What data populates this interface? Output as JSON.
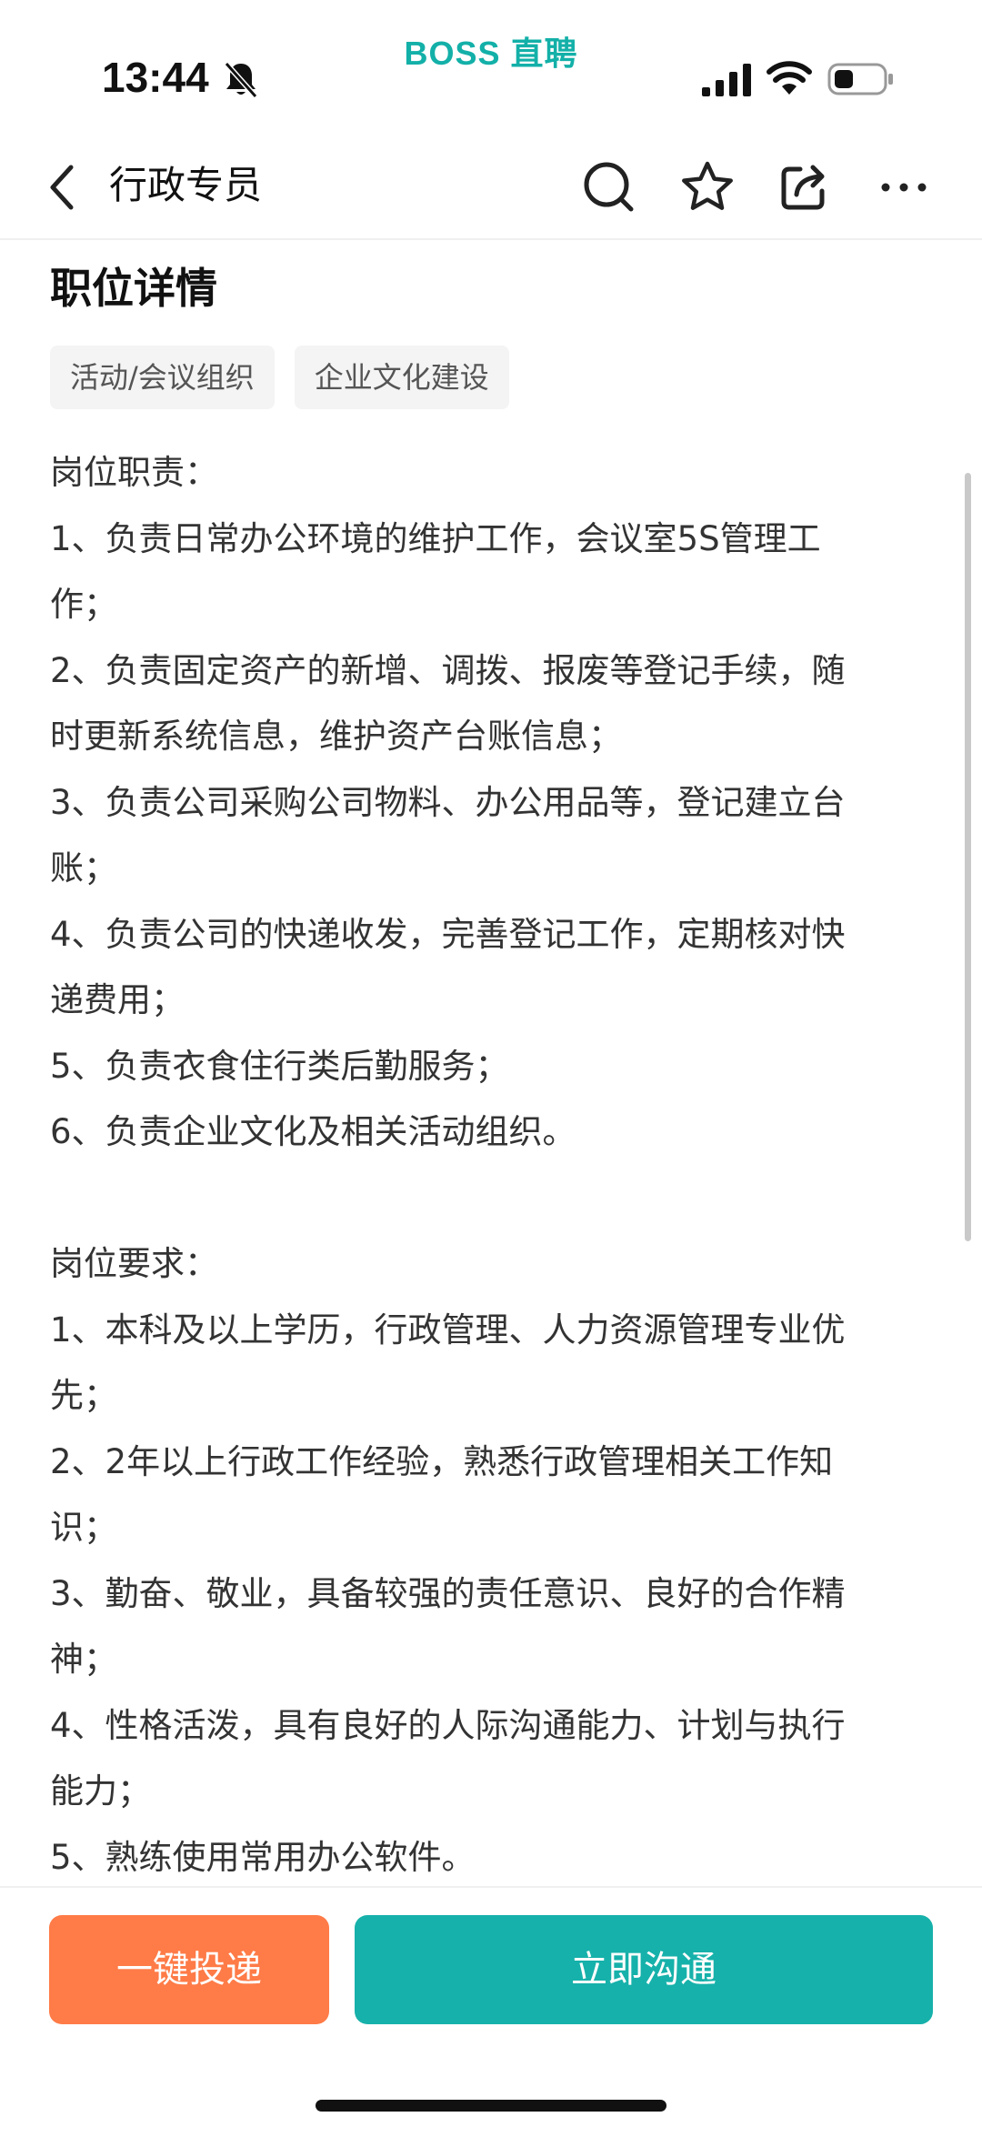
{
  "status_bar": {
    "time": "13:44",
    "app_watermark": "BOSS 直聘"
  },
  "nav": {
    "title": "行政专员",
    "icons": [
      "back-icon",
      "search-icon",
      "star-icon",
      "share-icon",
      "more-icon"
    ]
  },
  "section": {
    "title": "职位详情"
  },
  "tags": [
    "活动/会议组织",
    "企业文化建设"
  ],
  "description_lines": [
    "岗位职责：",
    "1、负责日常办公环境的维护工作，会议室5S管理工",
    "作；",
    "2、负责固定资产的新增、调拨、报废等登记手续，随",
    "时更新系统信息，维护资产台账信息；",
    "3、负责公司采购公司物料、办公用品等，登记建立台",
    "账；",
    "4、负责公司的快递收发，完善登记工作，定期核对快",
    "递费用；",
    "5、负责衣食住行类后勤服务；",
    "6、负责企业文化及相关活动组织。",
    "",
    "岗位要求：",
    "1、本科及以上学历，行政管理、人力资源管理专业优",
    "先；",
    "2、2年以上行政工作经验，熟悉行政管理相关工作知",
    "识；",
    "3、勤奋、敬业，具备较强的责任意识、良好的合作精",
    "神；",
    "4、性格活泼，具有良好的人际沟通能力、计划与执行",
    "能力；",
    "5、熟练使用常用办公软件。"
  ],
  "actions": {
    "apply_label": "一键投递",
    "chat_label": "立即沟通"
  },
  "colors": {
    "brand": "#16b1aa",
    "apply": "#ff7b47"
  }
}
